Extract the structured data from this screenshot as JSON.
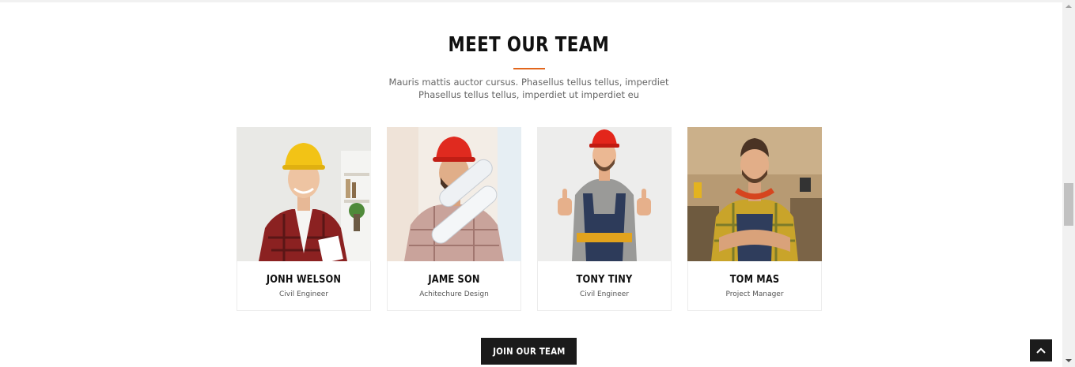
{
  "section": {
    "title": "MEET OUR TEAM",
    "subtitle_line1": "Mauris mattis auctor cursus. Phasellus tellus tellus, imperdiet",
    "subtitle_line2": "Phasellus tellus tellus, imperdiet ut imperdiet eu",
    "accent_color": "#e2661c"
  },
  "team": [
    {
      "name": "JONH WELSON",
      "role": "Civil Engineer",
      "helmet": "yellow"
    },
    {
      "name": "JAME SON",
      "role": "Achitechure Design",
      "helmet": "red"
    },
    {
      "name": "TONY TINY",
      "role": "Civil Engineer",
      "helmet": "red"
    },
    {
      "name": "TOM MAS",
      "role": "Project Manager",
      "helmet": "none"
    }
  ],
  "cta": {
    "label": "JOIN OUR TEAM"
  },
  "icons": {
    "back_to_top": "chevron-up-icon",
    "scroll_up": "arrow-up-icon",
    "scroll_down": "arrow-down-icon"
  }
}
